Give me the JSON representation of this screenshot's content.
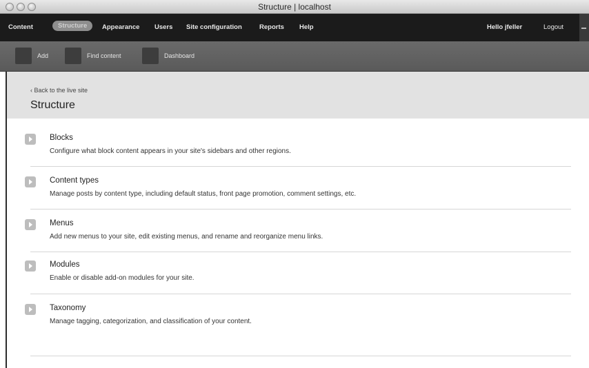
{
  "window": {
    "title": "Structure | localhost"
  },
  "toolbar": {
    "items": [
      "Content",
      "Structure",
      "Appearance",
      "Users",
      "Site configuration",
      "Reports",
      "Help"
    ],
    "active_index": 1,
    "user_greeting": "Hello jfeller",
    "logout": "Logout"
  },
  "shortcuts": [
    "Add",
    "Find content",
    "Dashboard"
  ],
  "header": {
    "back_link": "‹ Back to the live site",
    "title": "Structure"
  },
  "sections": [
    {
      "name": "Blocks",
      "description": "Configure what block content appears in your site's sidebars and other regions."
    },
    {
      "name": "Content types",
      "description": "Manage posts by content type, including default status, front page promotion, comment settings, etc."
    },
    {
      "name": "Menus",
      "description": "Add new menus to your site, edit existing menus, and rename and reorganize menu links."
    },
    {
      "name": "Modules",
      "description": "Enable or disable add-on modules for your site."
    },
    {
      "name": "Taxonomy",
      "description": "Manage tagging, categorization, and classification of your content."
    }
  ]
}
